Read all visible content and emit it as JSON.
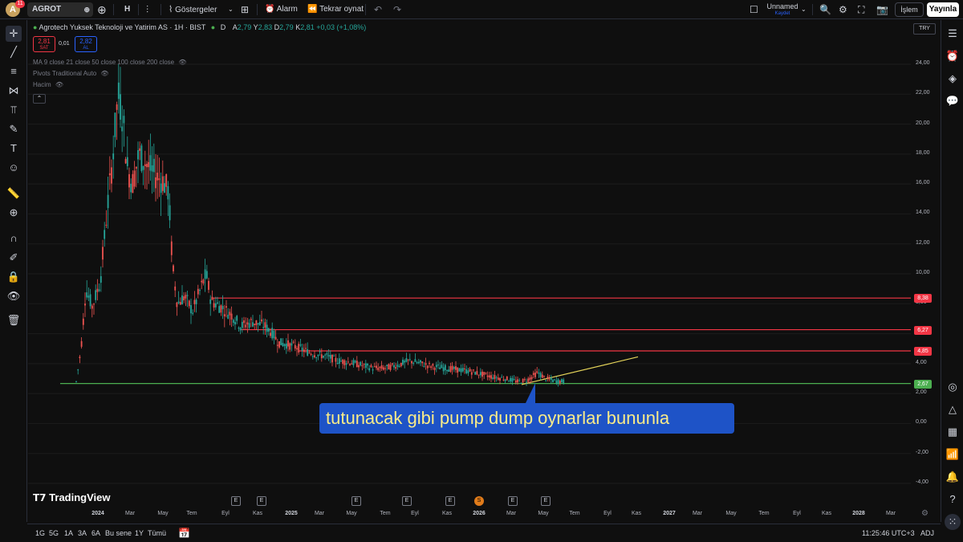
{
  "topbar": {
    "avatar_letter": "A",
    "notifications": "11",
    "symbol": "AGROT",
    "interval": "H",
    "indicators": "Göstergeler",
    "alarm": "Alarm",
    "replay": "Tekrar oynat",
    "layout_name": "Unnamed",
    "layout_sub": "Kaydet",
    "trade": "İşlem",
    "publish": "Yayınla"
  },
  "legend": {
    "title": "Agrotech Yuksek Teknoloji ve Yatirim AS · 1H · BIST",
    "d": "D",
    "o_label": "A",
    "o": "2,79",
    "h_label": "Y",
    "h": "2,83",
    "l_label": "D",
    "l": "2,79",
    "c_label": "K",
    "c": "2,81",
    "change": "+0,03 (+1,08%)",
    "sell_price": "2,81",
    "sell_label": "SAT",
    "spread": "0,01",
    "buy_price": "2,82",
    "buy_label": "AL",
    "ma": "MA 9 close 21 close 50 close 100 close 200 close",
    "pivots": "Pivots Traditional Auto",
    "volume": "Hacim",
    "currency": "TRY"
  },
  "annotation": "tutunacak gibi pump dump oynarlar bununla",
  "brand": "TradingView",
  "price_axis": [
    "24,00",
    "22,00",
    "20,00",
    "18,00",
    "16,00",
    "14,00",
    "12,00",
    "10,00",
    "8,00",
    "6,00",
    "4,00",
    "2,00",
    "0,00",
    "-2,00",
    "-4,00"
  ],
  "price_badges": [
    {
      "value": "8,38",
      "color": "#f23645"
    },
    {
      "value": "6,27",
      "color": "#f23645"
    },
    {
      "value": "4,85",
      "color": "#f23645"
    },
    {
      "value": "2,67",
      "color": "#4caf50"
    }
  ],
  "time_axis": [
    "2024",
    "Mar",
    "May",
    "Tem",
    "Eyl",
    "Kas",
    "2025",
    "Mar",
    "May",
    "Tem",
    "Eyl",
    "Kas",
    "2026",
    "Mar",
    "May",
    "Tem",
    "Eyl",
    "Kas",
    "2027",
    "Mar",
    "May",
    "Tem",
    "Eyl",
    "Kas",
    "2028",
    "Mar"
  ],
  "events": [
    "E",
    "E",
    "E",
    "E",
    "E",
    "S",
    "E",
    "E"
  ],
  "bottombar": {
    "ranges": [
      "1G",
      "5G",
      "1A",
      "3A",
      "6A",
      "Bu sene",
      "1Y",
      "Tümü"
    ],
    "clock": "11:25:46 UTC+3",
    "adj": "ADJ"
  },
  "chart_data": {
    "type": "candlestick",
    "title": "Agrotech Yuksek Teknoloji ve Yatirim AS · 1H · BIST",
    "ylim": [
      -5,
      25.5
    ],
    "horizontal_levels": [
      8.38,
      6.27,
      4.85,
      2.67
    ],
    "trendline": {
      "from": [
        0,
        2.6
      ],
      "to": [
        1,
        4.45
      ]
    },
    "series": [
      {
        "x": "2024-01",
        "values": [
          3.0,
          11.0,
          10.0,
          9.0,
          13.0
        ]
      },
      {
        "x": "2024-02",
        "values": [
          14.0,
          22.0,
          23.0,
          17.0,
          18.0
        ]
      },
      {
        "x": "2024-03",
        "values": [
          20.0,
          19.0,
          17.5,
          16.0,
          15.0
        ]
      },
      {
        "x": "2024-04",
        "values": [
          10.0,
          8.0,
          7.5,
          8.5,
          7.0
        ]
      },
      {
        "x": "2024-06",
        "values": [
          9.0,
          11.0,
          8.5,
          8.0,
          7.8
        ]
      },
      {
        "x": "2024-08",
        "values": [
          7.5,
          6.5,
          6.2,
          6.8,
          7.2
        ]
      },
      {
        "x": "2024-10",
        "values": [
          6.5,
          6.4,
          5.5,
          5.2,
          5.0
        ]
      },
      {
        "x": "2025-01",
        "values": [
          4.8,
          4.5,
          4.2,
          4.0,
          4.3
        ]
      },
      {
        "x": "2025-05",
        "values": [
          4.0,
          3.6,
          3.8,
          4.2,
          4.1
        ]
      },
      {
        "x": "2025-09",
        "values": [
          4.0,
          3.9,
          3.7,
          3.6,
          3.5
        ]
      },
      {
        "x": "2026-01",
        "values": [
          3.4,
          3.2,
          3.0,
          2.8,
          2.9
        ]
      },
      {
        "x": "2026-04",
        "values": [
          3.2,
          3.4,
          3.0,
          2.9,
          2.81
        ]
      }
    ]
  }
}
